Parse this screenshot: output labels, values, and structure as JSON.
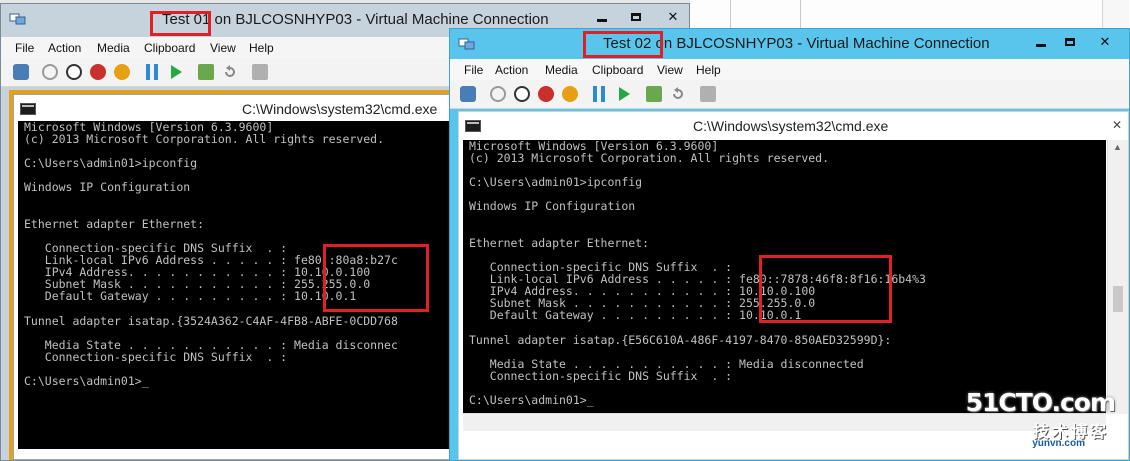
{
  "windows": [
    {
      "title_highlight": "Test 01",
      "title_rest": "on BJLCOSNHYP03 - Virtual Machine Connection",
      "menu": [
        "File",
        "Action",
        "Media",
        "Clipboard",
        "View",
        "Help"
      ],
      "cmd_title": "C:\\Windows\\system32\\cmd.exe",
      "console_lines": [
        "Microsoft Windows [Version 6.3.9600]",
        "(c) 2013 Microsoft Corporation. All rights reserved.",
        "",
        "C:\\Users\\admin01>ipconfig",
        "",
        "Windows IP Configuration",
        "",
        "",
        "Ethernet adapter Ethernet:",
        "",
        "   Connection-specific DNS Suffix  . :",
        "   Link-local IPv6 Address . . . . . : fe80::80a8:b27c",
        "   IPv4 Address. . . . . . . . . . . : 10.10.0.100",
        "   Subnet Mask . . . . . . . . . . . : 255.255.0.0",
        "   Default Gateway . . . . . . . . . : 10.10.0.1",
        "",
        "Tunnel adapter isatap.{3524A362-C4AF-4FB8-ABFE-0CDD768",
        "",
        "   Media State . . . . . . . . . . . : Media disconnec",
        "   Connection-specific DNS Suffix  . :",
        "",
        "C:\\Users\\admin01>_"
      ]
    },
    {
      "title_highlight": "Test 02",
      "title_rest": "on BJLCOSNHYP03 - Virtual Machine Connection",
      "menu": [
        "File",
        "Action",
        "Media",
        "Clipboard",
        "View",
        "Help"
      ],
      "cmd_title": "C:\\Windows\\system32\\cmd.exe",
      "console_lines": [
        "Microsoft Windows [Version 6.3.9600]",
        "(c) 2013 Microsoft Corporation. All rights reserved.",
        "",
        "C:\\Users\\admin01>ipconfig",
        "",
        "Windows IP Configuration",
        "",
        "",
        "Ethernet adapter Ethernet:",
        "",
        "   Connection-specific DNS Suffix  . :",
        "   Link-local IPv6 Address . . . . . : fe80::7878:46f8:8f16:16b4%3",
        "   IPv4 Address. . . . . . . . . . . : 10.10.0.100",
        "   Subnet Mask . . . . . . . . . . . : 255.255.0.0",
        "   Default Gateway . . . . . . . . . : 10.10.0.1",
        "",
        "Tunnel adapter isatap.{E56C610A-486F-4197-8470-850AED32599D}:",
        "",
        "   Media State . . . . . . . . . . . : Media disconnected",
        "   Connection-specific DNS Suffix  . :",
        "",
        "C:\\Users\\admin01>_"
      ]
    }
  ],
  "watermark": {
    "main": "51CTO.com",
    "sub": "技术博客",
    "url": "yunvn.com"
  },
  "colors": {
    "highlight_box": "#e01f26",
    "vm2_frame": "#59c5ec",
    "vm1_desktop": "#e4a11b",
    "console_bg": "#000000",
    "console_fg": "#c0c0c0"
  }
}
